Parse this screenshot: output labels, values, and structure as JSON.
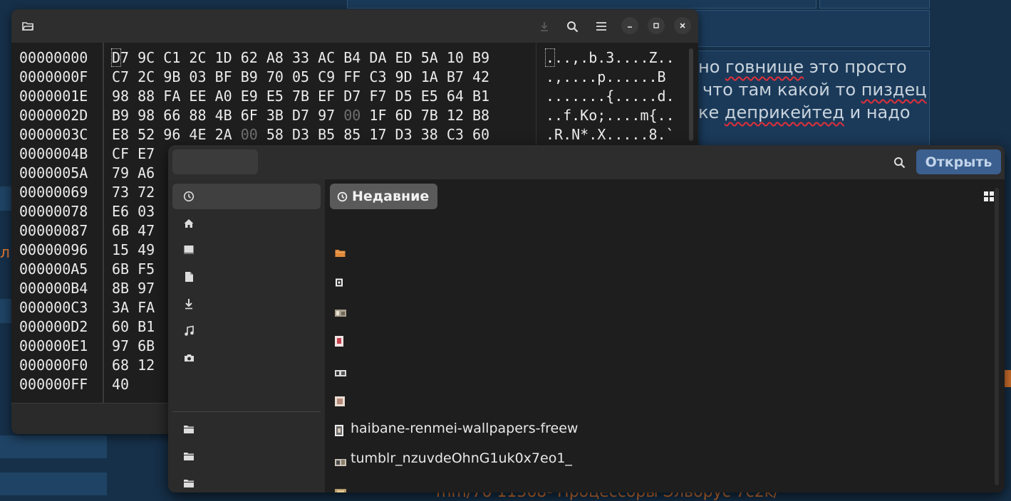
{
  "background": {
    "lines": [
      {
        "parts": [
          "но ",
          "говнище",
          " это просто"
        ],
        "squiggle": [
          1
        ]
      },
      {
        "parts": [
          "что там какой то ",
          "пиздец"
        ],
        "squiggle": [
          1
        ]
      },
      {
        "parts": [
          "ке ",
          "деприкейтед",
          " и надо"
        ],
        "squiggle": [
          1
        ]
      }
    ],
    "left_fragment": "л",
    "bottom_text": "mm/76 11368- Процессоры Эльбрус 7c2k/"
  },
  "hex_editor": {
    "icons": {
      "open": "folder-open-icon",
      "download": "download-icon",
      "search": "search-icon",
      "menu": "menu-icon",
      "minimize": "minimize-icon",
      "maximize": "maximize-icon",
      "close": "close-icon"
    },
    "offsets": [
      "00000000",
      "0000000F",
      "0000001E",
      "0000002D",
      "0000003C",
      "0000004B",
      "0000005A",
      "00000069",
      "00000078",
      "00000087",
      "00000096",
      "000000A5",
      "000000B4",
      "000000C3",
      "000000D2",
      "000000E1",
      "000000F0",
      "000000FF"
    ],
    "full_rows": [
      "D7 9C C1 2C 1D 62 A8 33 AC B4 DA ED 5A 10 B9",
      "C7 2C 9B 03 BF B9 70 05 C9 FF C3 9D 1A B7 42",
      "98 88 FA EE A0 E9 E5 7B EF D7 F7 D5 E5 64 B1",
      "B9 98 66 88 4B 6F 3B D7 97 00 1F 6D 7B 12 B8",
      "E8 52 96 4E 2A 00 58 D3 B5 85 17 D3 38 C3 60"
    ],
    "partial_rows": [
      "CF E7",
      "79 A6",
      "73 72",
      "E6 03",
      "6B 47",
      "15 49",
      "6B F5",
      "8B 97",
      "3A FA",
      "60 B1",
      "97 6B",
      "68 12",
      "40"
    ],
    "ascii_rows": [
      "...,.b.3....Z..",
      ".,....p......B",
      ".......{.....d.",
      "..f.Ko;....m{..",
      ".R.N*.X.....8.`"
    ]
  },
  "file_chooser": {
    "open_button": "Открыть",
    "location": "Недавние",
    "sidebar_icons": [
      "recent-icon",
      "home-icon",
      "desktop-icon",
      "document-icon",
      "download-icon",
      "music-icon",
      "camera-icon",
      "folder-icon",
      "folder-icon",
      "folder-icon",
      "folder-icon"
    ],
    "files": [
      {
        "name": "",
        "icon": "folder-icon"
      },
      {
        "name": "",
        "icon": "video-icon"
      },
      {
        "name": "",
        "icon": "image-icon"
      },
      {
        "name": "",
        "icon": "image-icon"
      },
      {
        "name": "",
        "icon": "image-icon"
      },
      {
        "name": "",
        "icon": "image-icon"
      },
      {
        "name": "haibane-renmei-wallpapers-freew",
        "icon": "image-icon"
      },
      {
        "name": "tumblr_nzuvdeOhnG1uk0x7eo1_",
        "icon": "image-icon"
      },
      {
        "name": "",
        "icon": "image-icon"
      }
    ],
    "colors": {
      "accent": "#3b5f8e",
      "folder": "#e08a3a"
    }
  }
}
